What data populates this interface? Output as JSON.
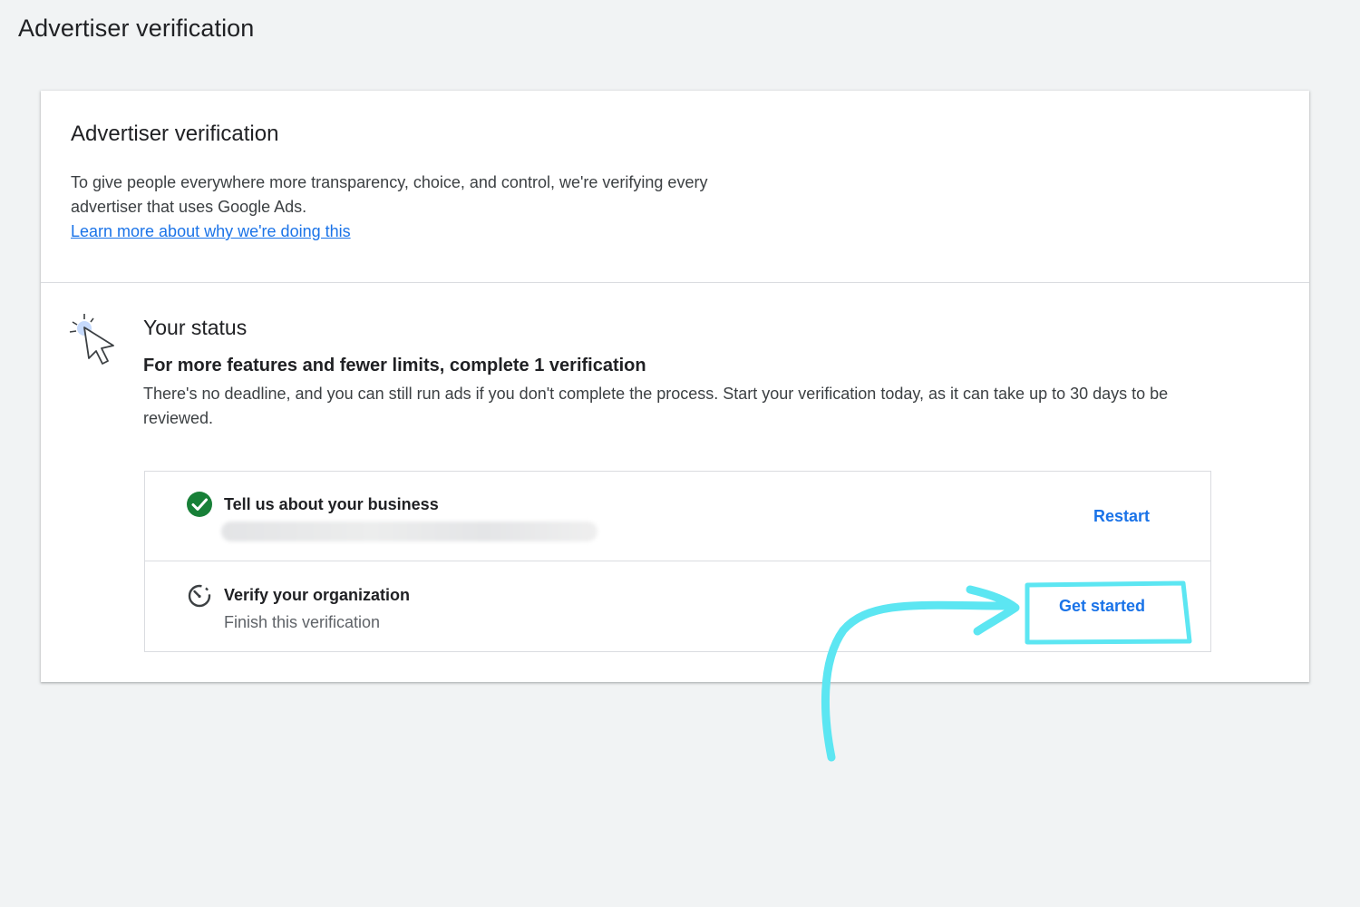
{
  "page": {
    "title": "Advertiser verification"
  },
  "card": {
    "title": "Advertiser verification",
    "description": "To give people everywhere more transparency, choice, and control, we're verifying every advertiser that uses Google Ads.",
    "learn_more_link": "Learn more about why we're doing this"
  },
  "status": {
    "icon": "cursor-click-icon",
    "title": "Your status",
    "headline": "For more features and fewer limits, complete 1 verification",
    "description": "There's no deadline, and you can still run ads if you don't complete the process. Start your verification today, as it can take up to 30 days to be reviewed."
  },
  "steps": [
    {
      "icon": "check-circle-icon",
      "title": "Tell us about your business",
      "subtitle_blurred": true,
      "action": "Restart"
    },
    {
      "icon": "timer-icon",
      "title": "Verify your organization",
      "subtitle": "Finish this verification",
      "action": "Get started"
    }
  ],
  "annotation": {
    "color": "#5ce6f2",
    "shape": "arrow-and-box"
  },
  "colors": {
    "background": "#f1f3f4",
    "link": "#1a73e8",
    "success": "#188038"
  }
}
